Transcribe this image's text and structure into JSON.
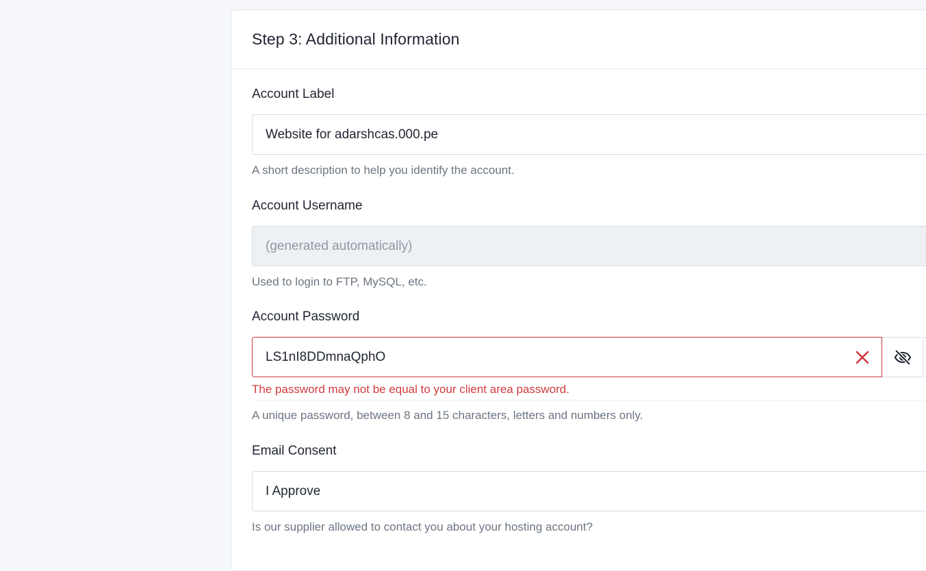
{
  "step": {
    "title": "Step 3: Additional Information"
  },
  "fields": {
    "account_label": {
      "label": "Account Label",
      "value": "Website for adarshcas.000.pe",
      "help": "A short description to help you identify the account."
    },
    "account_username": {
      "label": "Account Username",
      "placeholder": "(generated automatically)",
      "help": "Used to login to FTP, MySQL, etc."
    },
    "account_password": {
      "label": "Account Password",
      "value": "LS1nI8DDmnaQphO",
      "error": "The password may not be equal to your client area password.",
      "help": "A unique password, between 8 and 15 characters, letters and numbers only.",
      "clear_icon": "close-icon",
      "visibility_icon": "eye-off-icon"
    },
    "email_consent": {
      "label": "Email Consent",
      "value": "I Approve",
      "help": "Is our supplier allowed to contact you about your hosting account?"
    }
  },
  "colors": {
    "error": "#d03a3f",
    "page_background": "#f5f7fa",
    "disabled_background": "#eef1f4"
  }
}
